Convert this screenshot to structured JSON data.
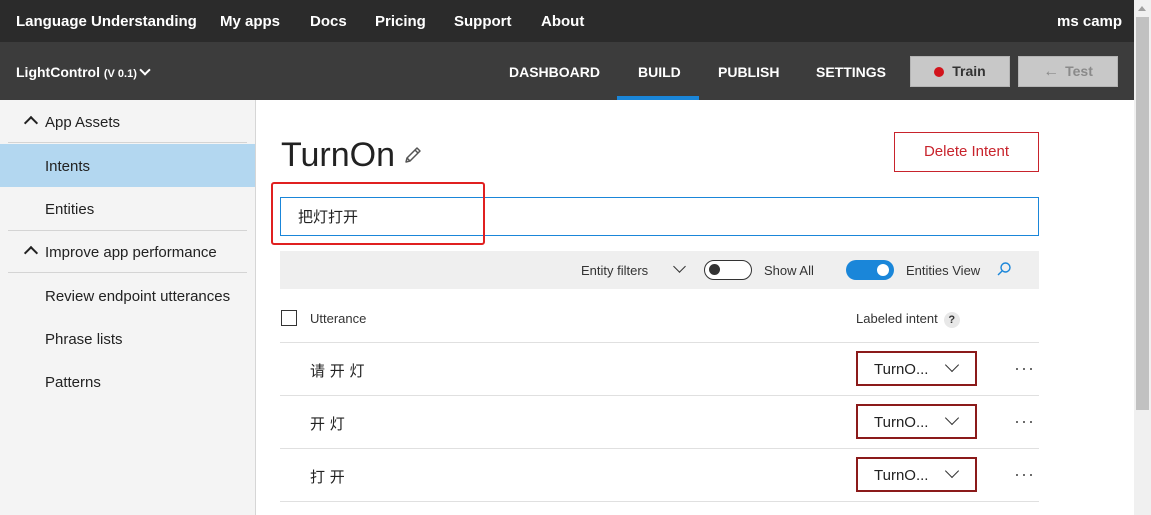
{
  "topnav": {
    "brand": "Language Understanding",
    "links": [
      "My apps",
      "Docs",
      "Pricing",
      "Support",
      "About"
    ],
    "user": "ms camp"
  },
  "appbar": {
    "app_name": "LightControl",
    "version": "(V 0.1)",
    "tabs": [
      "DASHBOARD",
      "BUILD",
      "PUBLISH",
      "SETTINGS"
    ],
    "active_tab": "BUILD",
    "train_label": "Train",
    "test_label": "Test"
  },
  "sidebar": {
    "section1": "App Assets",
    "items1": [
      "Intents",
      "Entities"
    ],
    "active_item": "Intents",
    "section2": "Improve app performance",
    "items2": [
      "Review endpoint utterances",
      "Phrase lists",
      "Patterns"
    ]
  },
  "main": {
    "title": "TurnOn",
    "delete_label": "Delete Intent",
    "utterance_input": "把灯打开",
    "filters": {
      "entity_filters": "Entity filters",
      "show_all": "Show All",
      "show_all_on": false,
      "entities_view": "Entities View",
      "entities_view_on": true
    },
    "table": {
      "col_utterance": "Utterance",
      "col_intent": "Labeled intent",
      "help": "?",
      "rows": [
        {
          "utterance": "请 开 灯",
          "intent": "TurnO..."
        },
        {
          "utterance": "开 灯",
          "intent": "TurnO..."
        },
        {
          "utterance": "打 开",
          "intent": "TurnO..."
        }
      ]
    }
  },
  "colors": {
    "accent": "#1a86d9",
    "danger": "#c8232c",
    "highlight_box": "#e02020"
  }
}
